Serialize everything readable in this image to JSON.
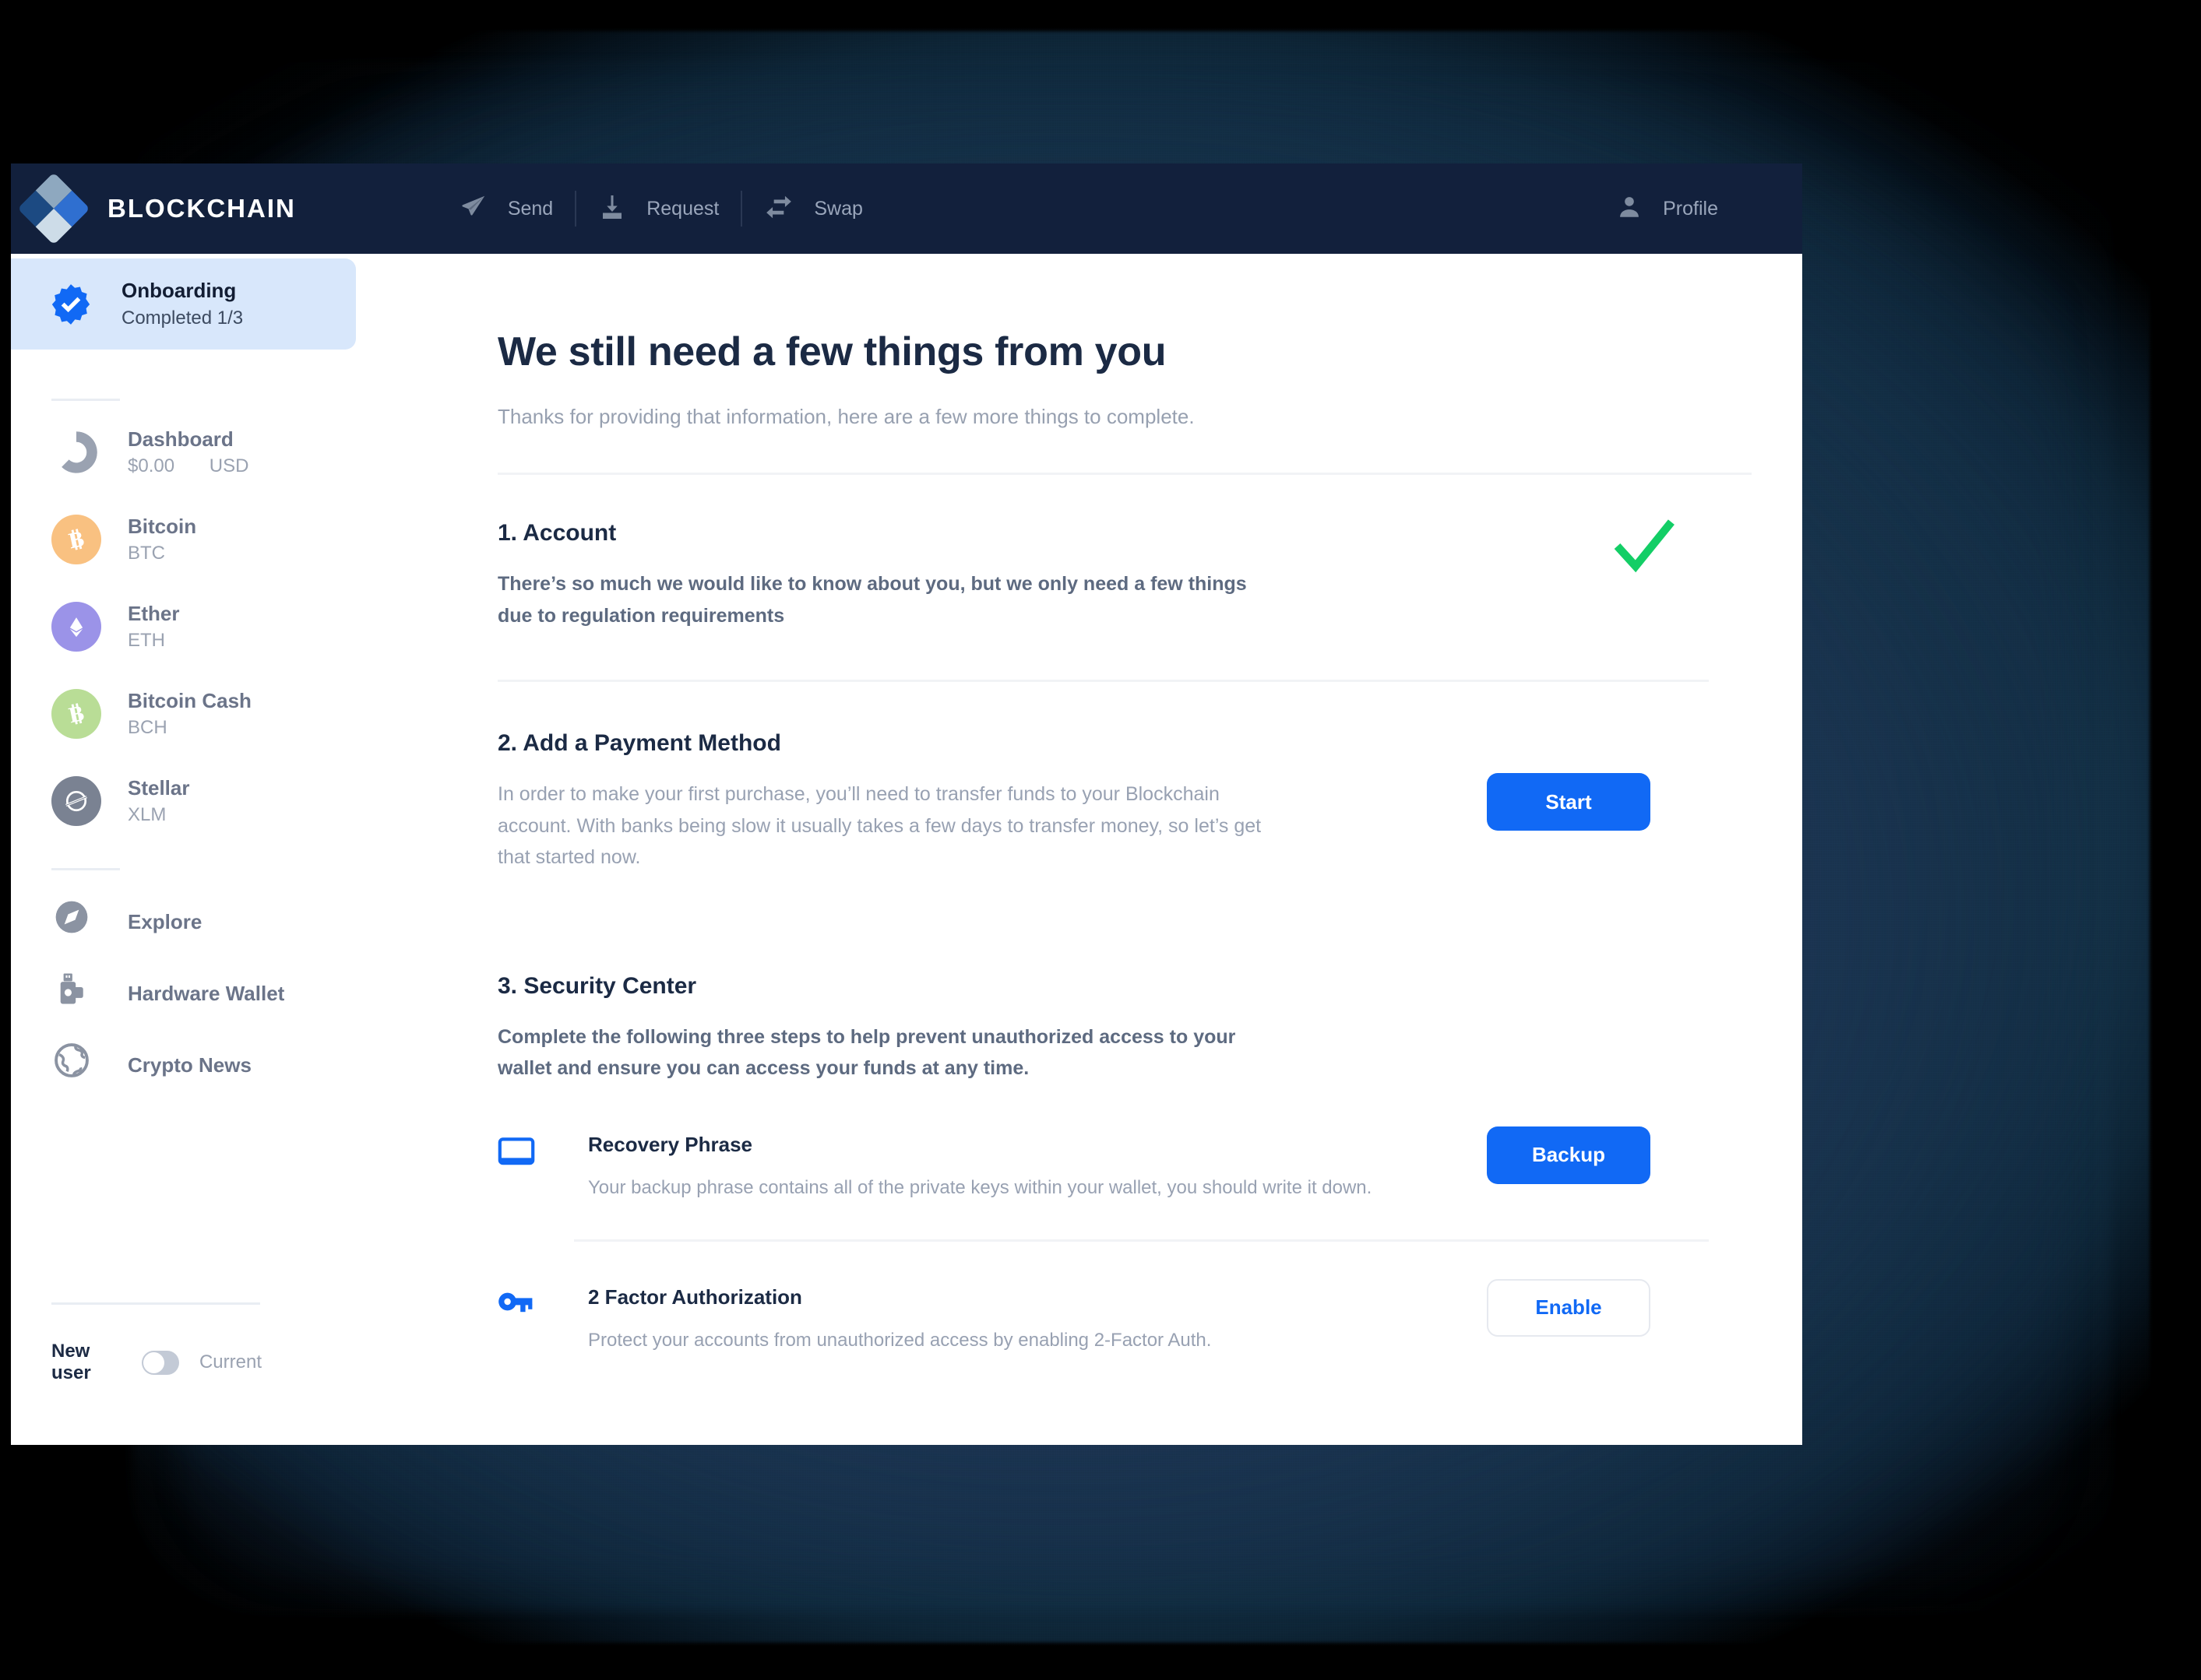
{
  "colors": {
    "nav_bg": "#12203c",
    "accent_blue": "#1169f5",
    "highlight_bg": "#d8e7fb",
    "success_green": "#13ce66",
    "title_navy": "#1b2a44",
    "muted_gray": "#98a1b2"
  },
  "topnav": {
    "brand": "BLOCKCHAIN",
    "brand_logo_icon": "blockchain-diamond-logo-icon",
    "links": [
      {
        "label": "Send",
        "icon": "send-paper-plane-icon"
      },
      {
        "label": "Request",
        "icon": "request-download-icon"
      },
      {
        "label": "Swap",
        "icon": "swap-arrows-icon"
      }
    ],
    "profile": {
      "label": "Profile",
      "icon": "person-icon"
    }
  },
  "sidebar": {
    "onboarding": {
      "title": "Onboarding",
      "subtitle": "Completed 1/3",
      "icon": "verified-badge-check-icon"
    },
    "wallets": [
      {
        "label": "Dashboard",
        "sub": "$0.00",
        "sub2": "USD",
        "icon": "donut-chart-icon",
        "color": "#9aa2b1"
      },
      {
        "label": "Bitcoin",
        "sub": "BTC",
        "icon": "bitcoin-icon",
        "color": "#f9c181",
        "symbol": "฿"
      },
      {
        "label": "Ether",
        "sub": "ETH",
        "icon": "ethereum-icon",
        "color": "#9b93e8",
        "symbol": ""
      },
      {
        "label": "Bitcoin Cash",
        "sub": "BCH",
        "icon": "bitcoin-cash-icon",
        "color": "#b9dd96",
        "symbol": "฿"
      },
      {
        "label": "Stellar",
        "sub": "XLM",
        "icon": "stellar-icon",
        "color": "#7a8292",
        "symbol": ""
      }
    ],
    "links": [
      {
        "label": "Explore",
        "icon": "compass-icon"
      },
      {
        "label": "Hardware Wallet",
        "icon": "usb-hardware-wallet-icon"
      },
      {
        "label": "Crypto News",
        "icon": "globe-news-icon"
      }
    ],
    "user_toggle": {
      "left_label": "New user",
      "right_label": "Current",
      "state": "off"
    }
  },
  "main": {
    "title": "We still need a few things from you",
    "subtitle": "Thanks for providing that information, here are a few more things to complete.",
    "sections": [
      {
        "heading": "1. Account",
        "body": "There’s so much we would like to know about you, but we only need a few things due to regulation requirements",
        "status_icon": "green-checkmark-icon"
      },
      {
        "heading": "2. Add a Payment Method",
        "body": "In order to make your first purchase, you’ll need to transfer funds to your Blockchain account. With banks being slow it usually takes a few days to transfer money, so let’s get that started now.",
        "action_label": "Start"
      },
      {
        "heading": "3. Security Center",
        "body": "Complete the following three steps to help prevent unauthorized access to your wallet and ensure you can access your funds at any time.",
        "rows": [
          {
            "title": "Recovery Phrase",
            "desc": "Your backup phrase contains all of the private keys within your wallet, you should write it down.",
            "icon": "recovery-phrase-card-icon",
            "action_label": "Backup",
            "action_style": "primary"
          },
          {
            "title": "2 Factor Authorization",
            "desc": "Protect your accounts from unauthorized access by enabling 2-Factor Auth.",
            "icon": "key-icon",
            "action_label": "Enable",
            "action_style": "outline"
          }
        ]
      }
    ]
  }
}
